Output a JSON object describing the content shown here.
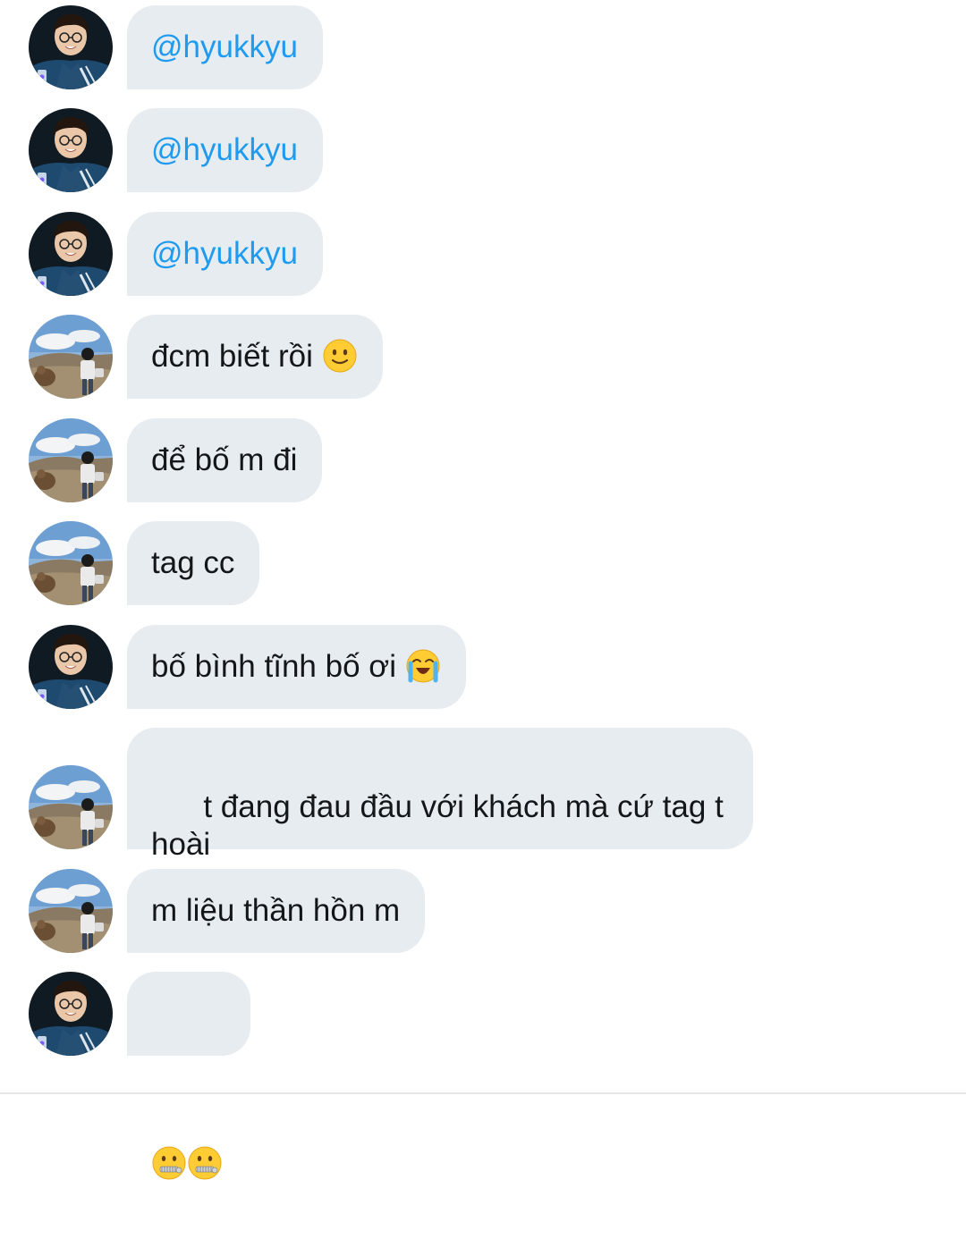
{
  "messages": [
    {
      "sender": "A",
      "text": "@hyukkyu",
      "mention": true
    },
    {
      "sender": "A",
      "text": "@hyukkyu",
      "mention": true
    },
    {
      "sender": "A",
      "text": "@hyukkyu",
      "mention": true
    },
    {
      "sender": "B",
      "text": "đcm biết rồi",
      "emoji": "slightly-smiling-face"
    },
    {
      "sender": "B",
      "text": "để bố m đi"
    },
    {
      "sender": "B",
      "text": "tag cc"
    },
    {
      "sender": "A",
      "text": "bố bình tĩnh bố ơi",
      "emoji": "loudly-crying-face"
    },
    {
      "sender": "B",
      "text": "t đang đau đầu với khách mà cứ tag t\nhoài"
    },
    {
      "sender": "B",
      "text": "m liệu thần hồn m"
    },
    {
      "sender": "A",
      "text": "",
      "emoji": "zipper-mouth-face-x2"
    }
  ],
  "colors": {
    "bubble_bg": "#e7ecf0",
    "text": "#14171a",
    "mention": "#1d9bf0"
  }
}
